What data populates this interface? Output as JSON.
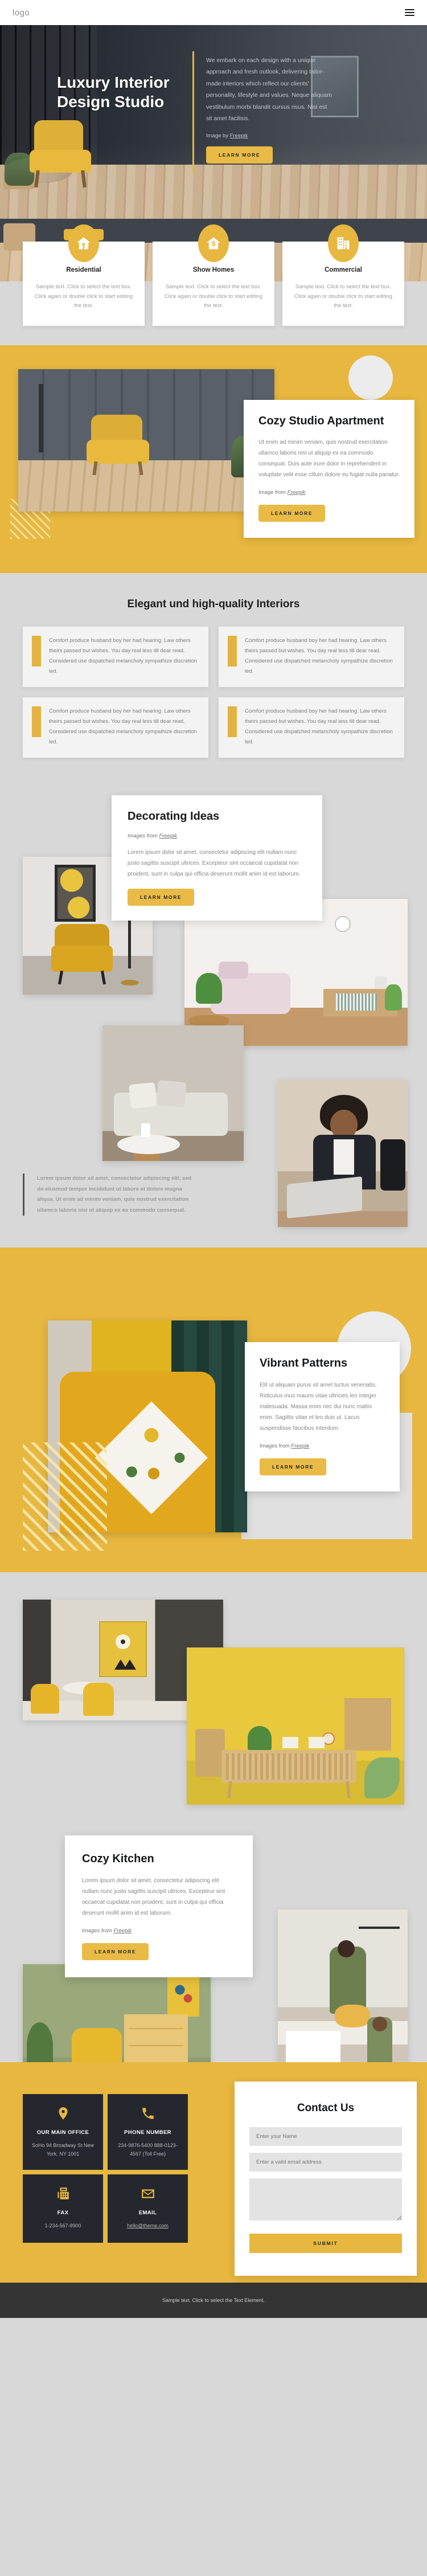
{
  "header": {
    "logo": "logo",
    "menu_icon": "hamburger-menu-icon"
  },
  "hero": {
    "title": "Luxury Interior Design Studio",
    "body": "We embark on each design with a unique approach and fresh outlook, delivering tailor-made interiors which reflect our clients' personality, lifestyle and values. Neque aliquam vestibulum morbi blandit cursus risus. Nisi est sit amet facilisis.",
    "credit_prefix": "Image by ",
    "credit_link": "Freepik",
    "button": "LEARN MORE"
  },
  "services": [
    {
      "icon": "house-icon",
      "title": "Residential",
      "text": "Sample text. Click to select the text box. Click again or double click to start editing the text."
    },
    {
      "icon": "house-dollar-icon",
      "title": "Show Homes",
      "text": "Sample text. Click to select the text box. Click again or double click to start editing the text."
    },
    {
      "icon": "office-building-icon",
      "title": "Commercial",
      "text": "Sample text. Click to select the text box. Click again or double click to start editing the text."
    }
  ],
  "studio": {
    "title": "Cozy Studio Apartment",
    "text": "Ut enim ad minim veniam, quis nostrud exercitation ullamco laboris nisi ut aliquip ex ea commodo consequat. Duis aute irure dolor in reprehenderit in voluptate velit esse cillum dolore eu fugiat nulla pariatur.",
    "credit_prefix": "Image from ",
    "credit_link": "Freepik",
    "button": "LEARN MORE"
  },
  "elegant": {
    "title": "Elegant und high-quality Interiors",
    "cards": [
      {
        "text": "Comfort produce husband boy her had hearing. Law others theirs passed but wishes. You day real less till dear read. Considered use dispatched melancholy sympathize discretion led."
      },
      {
        "text": "Comfort produce husband boy her had hearing. Law others theirs passed but wishes. You day real less till dear read. Considered use dispatched melancholy sympathize discretion led."
      },
      {
        "text": "Comfort produce husband boy her had hearing. Law others theirs passed but wishes. You day real less till dear read. Considered use dispatched melancholy sympathize discretion led."
      },
      {
        "text": "Comfort produce husband boy her had hearing. Law others theirs passed but wishes. You day real less till dear read. Considered use dispatched melancholy sympathize discretion led."
      }
    ]
  },
  "decorating": {
    "title": "Decorating Ideas",
    "credit_prefix": "Images from ",
    "credit_link": "Freepik",
    "text": "Lorem ipsum dolor sit amet, consectetur adipiscing elit nullam nunc justo sagittis suscipit ultrices. Excepteur sint occaecat cupidatat non proident, sunt in culpa qui officia deserunt mollit anim id est laborum.",
    "button": "LEARN MORE",
    "quote": "Lorem ipsum dolor sit amet, consectetur adipiscing elit, sed do eiusmod tempor incididunt ut labore et dolore magna aliqua. Ut enim ad minim veniam, quis nostrud exercitation ullamco laboris nisi ut aliquip ex ea commodo consequat."
  },
  "vibrant": {
    "title": "Vibrant Patterns",
    "text": "Elit ut aliquam purus sit amet luctus venenatis. Ridiculus mus mauris vitae ultricies leo integer malesuada. Massa enim nec dui nunc mattis enim. Sagittis vitae et leo duis ut. Lacus suspendisse faucibus interdum.",
    "credit_prefix": "Images from ",
    "credit_link": "Freepik",
    "button": "LEARN MORE"
  },
  "kitchen": {
    "title": "Cozy Kitchen",
    "text": "Lorem ipsum dolor sit amet, consectetur adipiscing elit nullam nunc justo sagittis suscipit ultrices. Excepteur sint occaecat cupidatat non proident, sunt in culpa qui officia deserunt mollit anim id est laborum.",
    "credit_prefix": "Images from ",
    "credit_link": "Freepik",
    "button": "LEARN MORE"
  },
  "contact": {
    "tiles": [
      {
        "icon": "map-pin-icon",
        "title": "OUR MAIN OFFICE",
        "text": "SoHo 94 Broadway St New York, NY 1001"
      },
      {
        "icon": "phone-icon",
        "title": "PHONE NUMBER",
        "text": "234-9876-5400 888-0123-4567 (Toll Free)"
      },
      {
        "icon": "fax-icon",
        "title": "FAX",
        "text": "1-234-567-8900"
      },
      {
        "icon": "envelope-icon",
        "title": "EMAIL",
        "text": "hello@theme.com"
      }
    ],
    "form": {
      "title": "Contact Us",
      "name_placeholder": "Enter your Name",
      "email_placeholder": "Enter a valid email address",
      "message_placeholder": "",
      "submit": "SUBMIT"
    }
  },
  "footer": {
    "text": "Sample text. Click to select the Text Element."
  },
  "colors": {
    "accent": "#e7b73f",
    "dark": "#24272e",
    "page_bg": "#d8d8d8",
    "footer_bg": "#343434"
  }
}
